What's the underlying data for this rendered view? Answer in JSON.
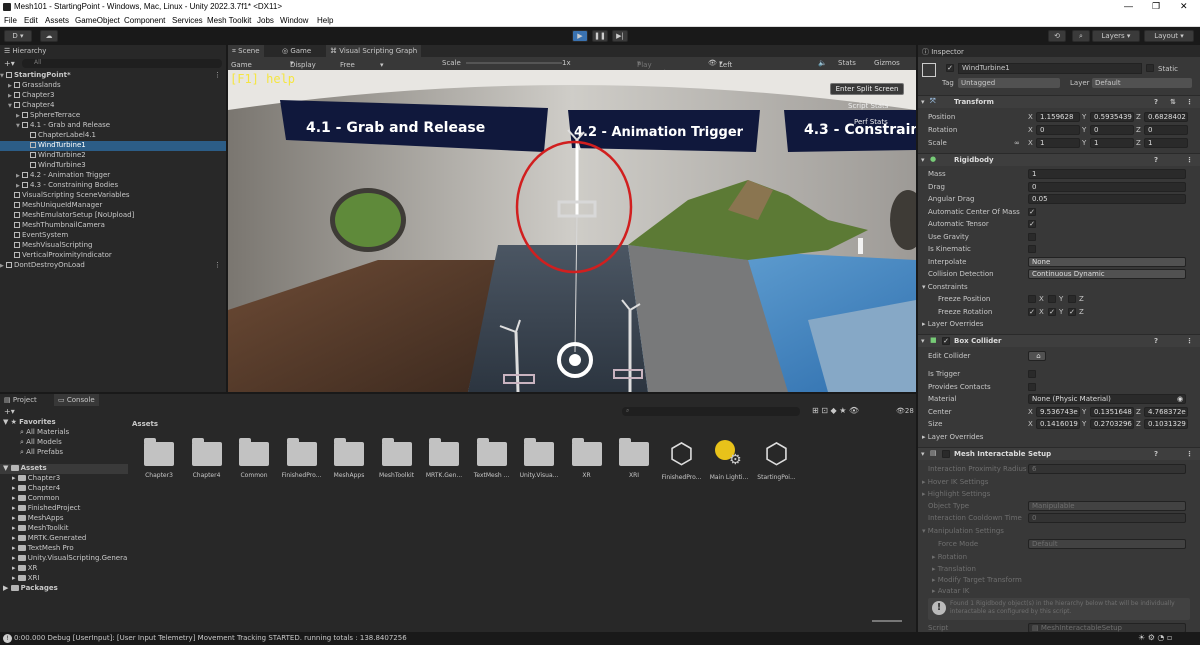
{
  "title": "Mesh101 - StartingPoint - Windows, Mac, Linux - Unity 2022.3.7f1* <DX11>",
  "menu": [
    "File",
    "Edit",
    "Assets",
    "GameObject",
    "Component",
    "Services",
    "Mesh Toolkit",
    "Jobs",
    "Window",
    "Help"
  ],
  "toolbar": {
    "account": "D",
    "layers": "Layers",
    "layout": "Layout"
  },
  "hierarchy": {
    "tab": "Hierarchy",
    "search_placeholder": "All",
    "rows": [
      {
        "label": "StartingPoint*",
        "level": 0,
        "bold": true
      },
      {
        "label": "Grasslands",
        "level": 1
      },
      {
        "label": "Chapter3",
        "level": 1
      },
      {
        "label": "Chapter4",
        "level": 1
      },
      {
        "label": "SphereTerrace",
        "level": 2
      },
      {
        "label": "4.1 - Grab and Release",
        "level": 2
      },
      {
        "label": "ChapterLabel4.1",
        "level": 3
      },
      {
        "label": "WindTurbine1",
        "level": 3,
        "selected": true
      },
      {
        "label": "WindTurbine2",
        "level": 3
      },
      {
        "label": "WindTurbine3",
        "level": 3
      },
      {
        "label": "4.2 - Animation Trigger",
        "level": 2
      },
      {
        "label": "4.3 - Constraining Bodies",
        "level": 2
      },
      {
        "label": "VisualScripting SceneVariables",
        "level": 1
      },
      {
        "label": "MeshUniqueIdManager",
        "level": 1
      },
      {
        "label": "MeshEmulatorSetup [NoUpload]",
        "level": 1
      },
      {
        "label": "MeshThumbnailCamera",
        "level": 1
      },
      {
        "label": "EventSystem",
        "level": 1
      },
      {
        "label": "MeshVisualScripting",
        "level": 1
      },
      {
        "label": "VerticalProximityIndicator",
        "level": 1
      },
      {
        "label": "DontDestroyOnLoad",
        "level": 0
      }
    ]
  },
  "viewtabs": [
    "Scene",
    "Game",
    "Visual Scripting Graph"
  ],
  "gamebar": {
    "mode": "Game",
    "display": "Display 1",
    "aspect": "Free Aspect",
    "scale_label": "Scale",
    "scale_value": "1x",
    "play_focused": "Play Focused",
    "eye": "Left Eye",
    "stats": "Stats",
    "gizmos": "Gizmos"
  },
  "scene": {
    "help": "[F1] help",
    "split_button": "Enter Split Screen",
    "overlay1": "Script Stats",
    "overlay2": "Perf Stats",
    "signs": [
      "4.1 - Grab and Release",
      "4.2 - Animation Trigger",
      "4.3 - Constrain"
    ]
  },
  "inspector": {
    "tab": "Inspector",
    "object_name": "WindTurbine1",
    "static": "Static",
    "tag_label": "Tag",
    "tag": "Untagged",
    "layer_label": "Layer",
    "layer": "Default",
    "transform": {
      "title": "Transform",
      "position": {
        "label": "Position",
        "x": "1.159628",
        "y": "0.5935439",
        "z": "0.6828402"
      },
      "rotation": {
        "label": "Rotation",
        "x": "0",
        "y": "0",
        "z": "0"
      },
      "scale": {
        "label": "Scale",
        "x": "1",
        "y": "1",
        "z": "1"
      }
    },
    "rigidbody": {
      "title": "Rigidbody",
      "mass": {
        "label": "Mass",
        "value": "1"
      },
      "drag": {
        "label": "Drag",
        "value": "0"
      },
      "angular": {
        "label": "Angular Drag",
        "value": "0.05"
      },
      "acom": "Automatic Center Of Mass",
      "atensor": "Automatic Tensor",
      "gravity": "Use Gravity",
      "kinematic": "Is Kinematic",
      "interpolate": {
        "label": "Interpolate",
        "value": "None"
      },
      "collision": {
        "label": "Collision Detection",
        "value": "Continuous Dynamic"
      },
      "constraints": "Constraints",
      "freeze_pos": "Freeze Position",
      "freeze_rot": "Freeze Rotation",
      "overrides": "Layer Overrides"
    },
    "box": {
      "title": "Box Collider",
      "edit": "Edit Collider",
      "trigger": "Is Trigger",
      "contacts": "Provides Contacts",
      "material": {
        "label": "Material",
        "value": "None (Physic Material)"
      },
      "center": {
        "label": "Center",
        "x": "9.536743e",
        "y": "0.1351648",
        "z": "4.768372e"
      },
      "size": {
        "label": "Size",
        "x": "0.1416019",
        "y": "0.2703296",
        "z": "0.1031329"
      },
      "overrides": "Layer Overrides"
    },
    "mesh": {
      "title": "Mesh Interactable Setup",
      "radius": {
        "label": "Interaction Proximity Radius",
        "value": "6"
      },
      "hover": "Hover IK Settings",
      "highlight": "Highlight Settings",
      "type": {
        "label": "Object Type",
        "value": "Manipulable"
      },
      "cooldown": {
        "label": "Interaction Cooldown Time",
        "value": "0"
      },
      "manip": "Manipulation Settings",
      "force": {
        "label": "Force Mode",
        "value": "Default"
      },
      "rotation": "Rotation",
      "translation": "Translation",
      "modify": "Modify Target Transform",
      "avatar": "Avatar IK",
      "info": "Found 1 Rigidbody object(s) in the hierarchy below that will be individually interactable as configured by this script.",
      "script_label": "Script",
      "script": "MeshInteractableSetup"
    }
  },
  "project": {
    "tabs": [
      "Project",
      "Console"
    ],
    "favorites": "Favorites",
    "fav_items": [
      "All Materials",
      "All Models",
      "All Prefabs"
    ],
    "assets_root": "Assets",
    "tree": [
      "Chapter3",
      "Chapter4",
      "Common",
      "FinishedProject",
      "MeshApps",
      "MeshToolkit",
      "MRTK.Generated",
      "TextMesh Pro",
      "Unity.VisualScripting.Genera",
      "XR",
      "XRI"
    ],
    "packages": "Packages",
    "grid_title": "Assets",
    "count": "28",
    "items": [
      {
        "name": "Chapter3",
        "kind": "folder"
      },
      {
        "name": "Chapter4",
        "kind": "folder"
      },
      {
        "name": "Common",
        "kind": "folder"
      },
      {
        "name": "FinishedPro...",
        "kind": "folder"
      },
      {
        "name": "MeshApps",
        "kind": "folder"
      },
      {
        "name": "MeshToolkit",
        "kind": "folder"
      },
      {
        "name": "MRTK.Gen...",
        "kind": "folder"
      },
      {
        "name": "TextMesh ...",
        "kind": "folder"
      },
      {
        "name": "Unity.Visua...",
        "kind": "folder"
      },
      {
        "name": "XR",
        "kind": "folder"
      },
      {
        "name": "XRI",
        "kind": "folder"
      },
      {
        "name": "FinishedPro...",
        "kind": "unity"
      },
      {
        "name": "Main Lighti...",
        "kind": "light"
      },
      {
        "name": "StartingPoi...",
        "kind": "unity"
      }
    ]
  },
  "status": "0:00.000 Debug [UserInput]: [User Input Telemetry] Movement Tracking STARTED. running totals : 138.8407256"
}
